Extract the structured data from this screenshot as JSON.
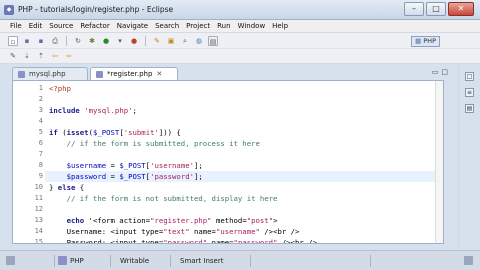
{
  "window": {
    "title": "PHP - tutorials/login/register.php - Eclipse",
    "icon": "eclipse-app-icon"
  },
  "menu": [
    "File",
    "Edit",
    "Source",
    "Refactor",
    "Navigate",
    "Search",
    "Project",
    "Run",
    "Window",
    "Help"
  ],
  "perspective": {
    "label": "PHP"
  },
  "tabs": [
    {
      "label": "mysql.php",
      "active": false
    },
    {
      "label": "*register.php",
      "active": true
    }
  ],
  "code": [
    {
      "n": "1",
      "text": "<?php"
    },
    {
      "n": "2",
      "text": ""
    },
    {
      "n": "3",
      "text": "include 'mysql.php';"
    },
    {
      "n": "4",
      "text": ""
    },
    {
      "n": "5",
      "text": "if (isset($_POST['submit'])) {"
    },
    {
      "n": "6",
      "text": "    // if the form is submitted, process it here"
    },
    {
      "n": "7",
      "text": ""
    },
    {
      "n": "8",
      "text": "    $username = $_POST['username'];"
    },
    {
      "n": "9",
      "text": "    $password = $_POST['password'];"
    },
    {
      "n": "10",
      "text": "} else {"
    },
    {
      "n": "11",
      "text": "    // if the form is not submitted, display it here"
    },
    {
      "n": "12",
      "text": ""
    },
    {
      "n": "13",
      "text": "    echo '<form action=\"register.php\" method=\"post\">"
    },
    {
      "n": "14",
      "text": "    Username: <input type=\"text\" name=\"username\" /><br />"
    },
    {
      "n": "15",
      "text": "    Password: <input type=\"password\" name=\"password\" /><br />"
    }
  ],
  "current_line": "9",
  "status": {
    "language": "PHP",
    "mode": "Writable",
    "insert": "Smart Insert"
  },
  "colors": {
    "keyword": "#1a1a8a",
    "variable": "#0000c0",
    "string": "#a71d5d",
    "comment": "#3f7f5f"
  }
}
